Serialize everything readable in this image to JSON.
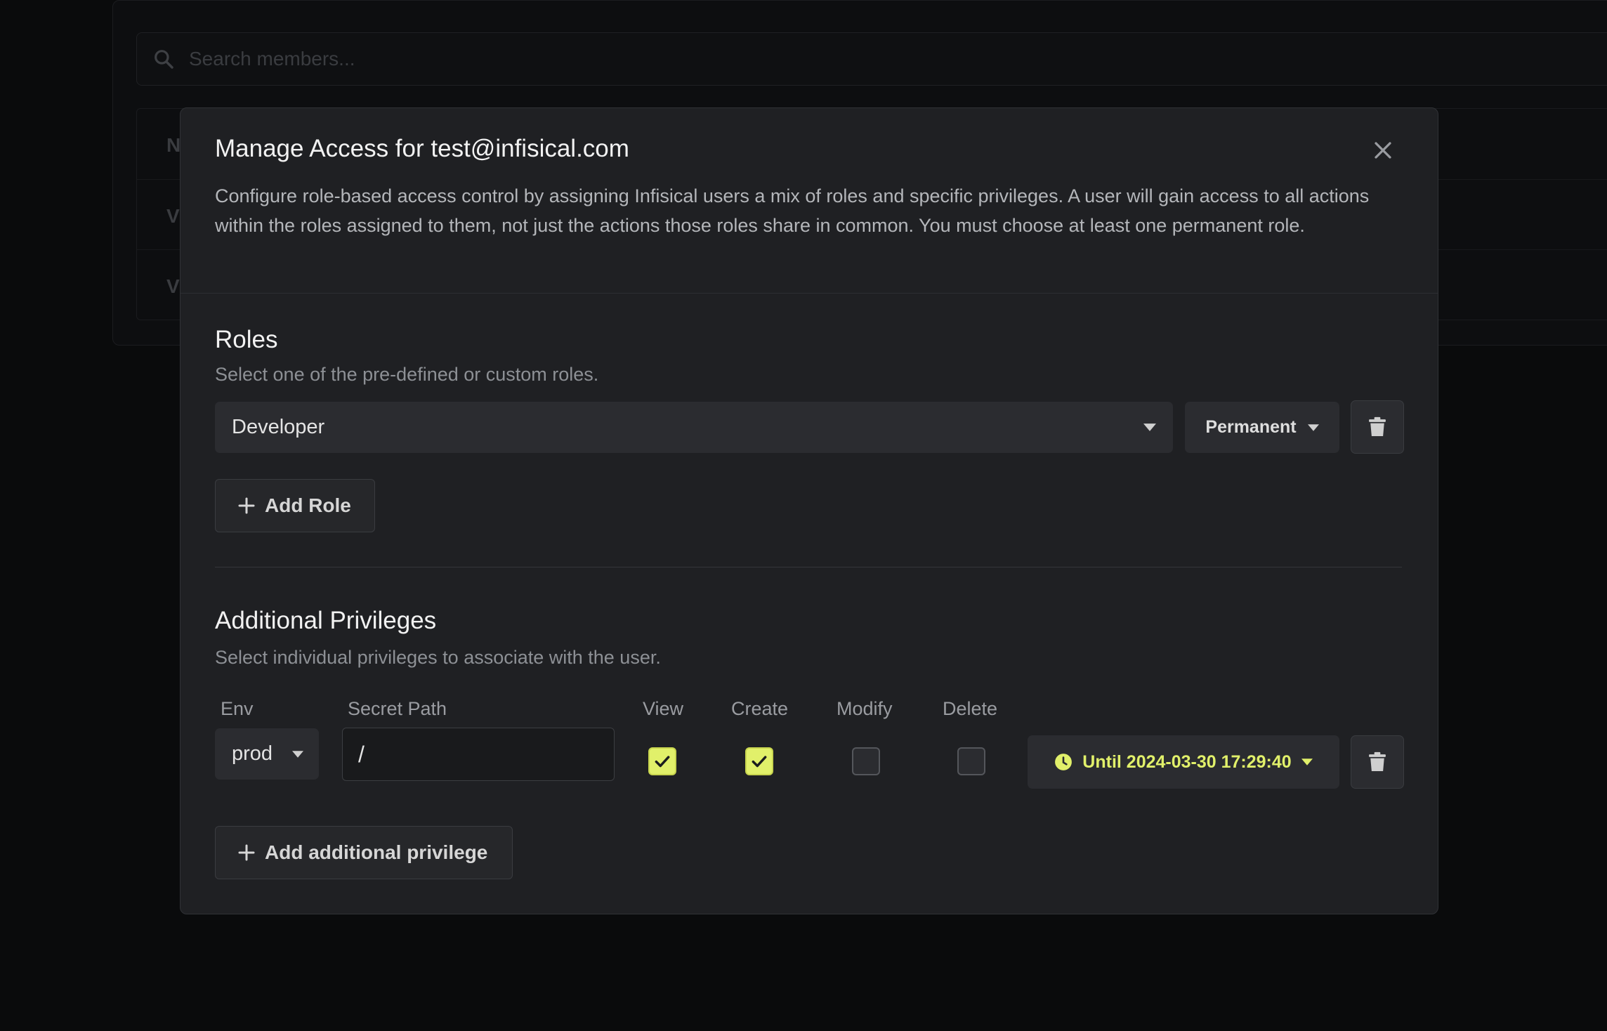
{
  "background": {
    "search_placeholder": "Search members...",
    "table_header_fragment": "N",
    "row_fragments": [
      "V",
      "V"
    ]
  },
  "modal": {
    "title": "Manage Access for test@infisical.com",
    "description": "Configure role-based access control by assigning Infisical users a mix of roles and specific privileges. A user will gain access to all actions within the roles assigned to them, not just the actions those roles share in common. You must choose at least one permanent role.",
    "roles": {
      "title": "Roles",
      "subtitle": "Select one of the pre-defined or custom roles.",
      "selected_role": "Developer",
      "duration": "Permanent",
      "add_label": "Add Role"
    },
    "privileges": {
      "title": "Additional Privileges",
      "subtitle": "Select individual privileges to associate with the user.",
      "columns": {
        "env": "Env",
        "path": "Secret Path",
        "view": "View",
        "create": "Create",
        "modify": "Modify",
        "delete": "Delete"
      },
      "row": {
        "env": "prod",
        "path": "/",
        "view": true,
        "create": true,
        "modify": false,
        "delete": false,
        "until": "Until 2024-03-30 17:29:40"
      },
      "add_label": "Add additional privilege"
    }
  },
  "colors": {
    "accent": "#e1f06a",
    "modal_bg": "#1f2023",
    "control_bg": "#2b2c30"
  }
}
